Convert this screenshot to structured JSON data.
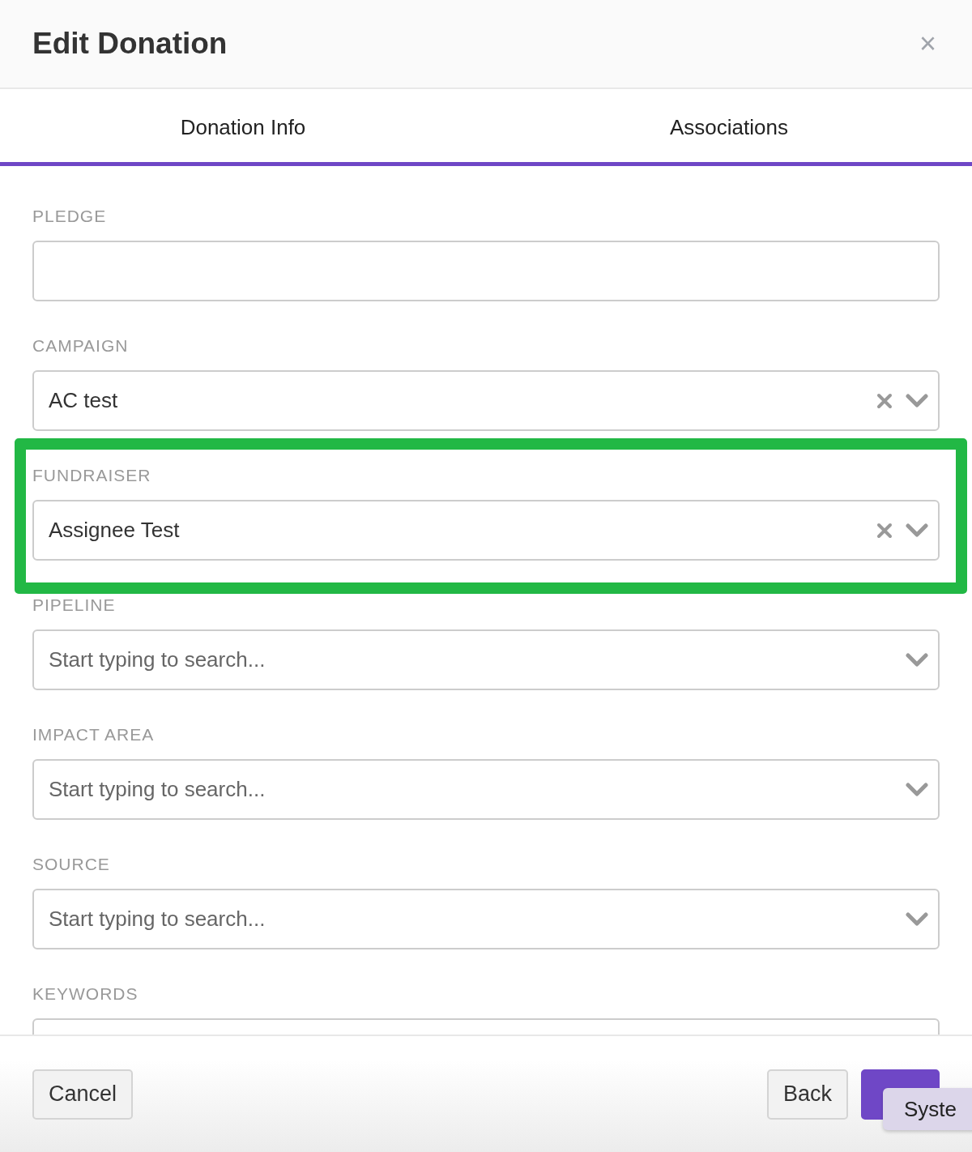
{
  "modal": {
    "title": "Edit Donation",
    "close": "×"
  },
  "tabs": [
    {
      "label": "Donation Info"
    },
    {
      "label": "Associations"
    }
  ],
  "fields": [
    {
      "label": "PLEDGE",
      "kind": "text",
      "highlighted": false
    },
    {
      "label": "CAMPAIGN",
      "kind": "select",
      "value": "AC test",
      "clearable": true,
      "highlighted": false
    },
    {
      "label": "FUNDRAISER",
      "kind": "select",
      "value": "Assignee Test",
      "clearable": true,
      "highlighted": true
    },
    {
      "label": "PIPELINE",
      "kind": "select",
      "placeholder": "Start typing to search...",
      "clearable": false,
      "highlighted": false
    },
    {
      "label": "IMPACT AREA",
      "kind": "select",
      "placeholder": "Start typing to search...",
      "clearable": false,
      "highlighted": false
    },
    {
      "label": "SOURCE",
      "kind": "select",
      "placeholder": "Start typing to search...",
      "clearable": false,
      "highlighted": false
    },
    {
      "label": "KEYWORDS",
      "kind": "text",
      "highlighted": false
    }
  ],
  "footer": {
    "cancel": "Cancel",
    "back": "Back"
  },
  "tooltip": "Syste"
}
